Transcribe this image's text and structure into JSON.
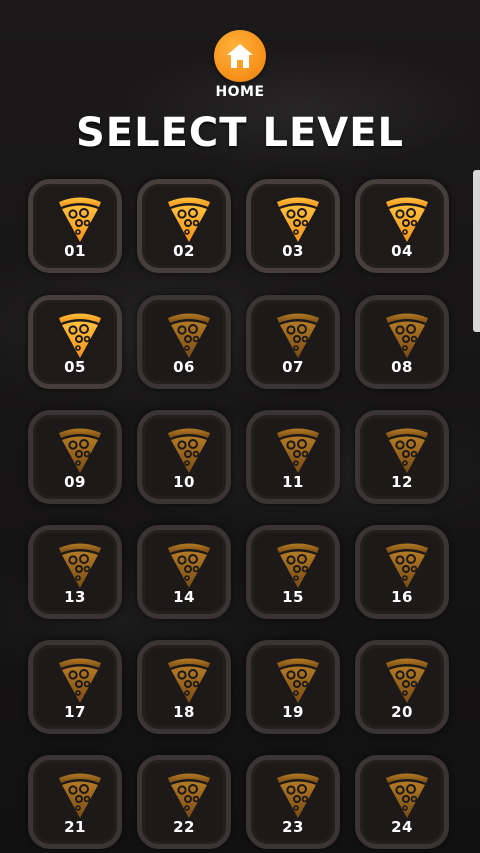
{
  "header": {
    "home_label": "HOME",
    "title": "SELECT LEVEL"
  },
  "colors": {
    "unlocked_pizza": "#ffa726",
    "locked_pizza": "#a0661a",
    "home_button": "#f7941d"
  },
  "levels": [
    {
      "label": "01",
      "unlocked": true
    },
    {
      "label": "02",
      "unlocked": true
    },
    {
      "label": "03",
      "unlocked": true
    },
    {
      "label": "04",
      "unlocked": true
    },
    {
      "label": "05",
      "unlocked": true
    },
    {
      "label": "06",
      "unlocked": false
    },
    {
      "label": "07",
      "unlocked": false
    },
    {
      "label": "08",
      "unlocked": false
    },
    {
      "label": "09",
      "unlocked": false
    },
    {
      "label": "10",
      "unlocked": false
    },
    {
      "label": "11",
      "unlocked": false
    },
    {
      "label": "12",
      "unlocked": false
    },
    {
      "label": "13",
      "unlocked": false
    },
    {
      "label": "14",
      "unlocked": false
    },
    {
      "label": "15",
      "unlocked": false
    },
    {
      "label": "16",
      "unlocked": false
    },
    {
      "label": "17",
      "unlocked": false
    },
    {
      "label": "18",
      "unlocked": false
    },
    {
      "label": "19",
      "unlocked": false
    },
    {
      "label": "20",
      "unlocked": false
    },
    {
      "label": "21",
      "unlocked": false
    },
    {
      "label": "22",
      "unlocked": false
    },
    {
      "label": "23",
      "unlocked": false
    },
    {
      "label": "24",
      "unlocked": false
    }
  ]
}
